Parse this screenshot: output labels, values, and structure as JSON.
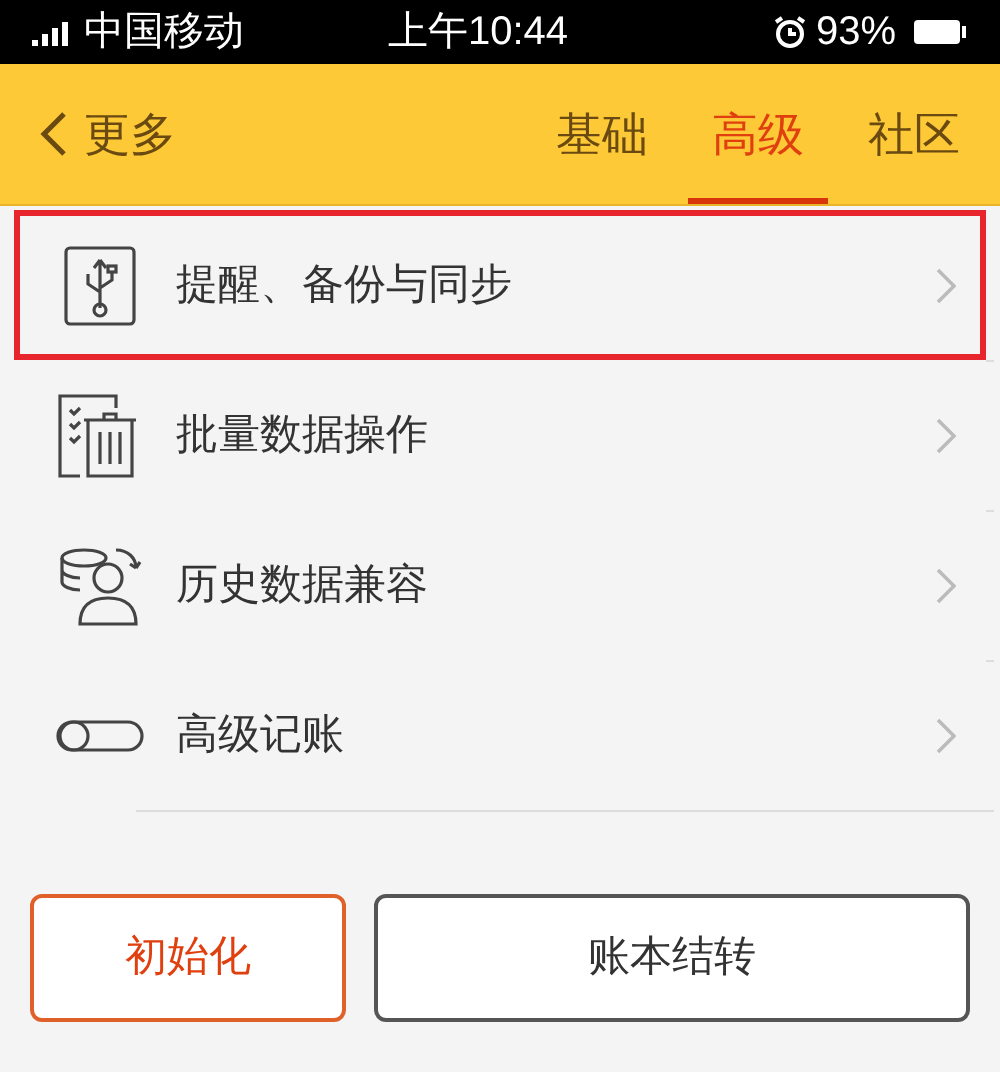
{
  "status_bar": {
    "carrier": "中国移动",
    "time": "上午10:44",
    "battery": "93%"
  },
  "header": {
    "back": "更多",
    "tabs": [
      {
        "label": "基础",
        "selected": false
      },
      {
        "label": "高级",
        "selected": true
      },
      {
        "label": "社区",
        "selected": false
      }
    ]
  },
  "items": [
    {
      "kind": "usb",
      "label": "提醒、备份与同步",
      "highlighted": true
    },
    {
      "kind": "batch",
      "label": "批量数据操作",
      "highlighted": false
    },
    {
      "kind": "history",
      "label": "历史数据兼容",
      "highlighted": false
    },
    {
      "kind": "toggle",
      "label": "高级记账",
      "highlighted": false
    }
  ],
  "buttons": [
    {
      "label": "初始化",
      "kind": "primary"
    },
    {
      "label": "账本结转",
      "kind": "secondary"
    }
  ]
}
